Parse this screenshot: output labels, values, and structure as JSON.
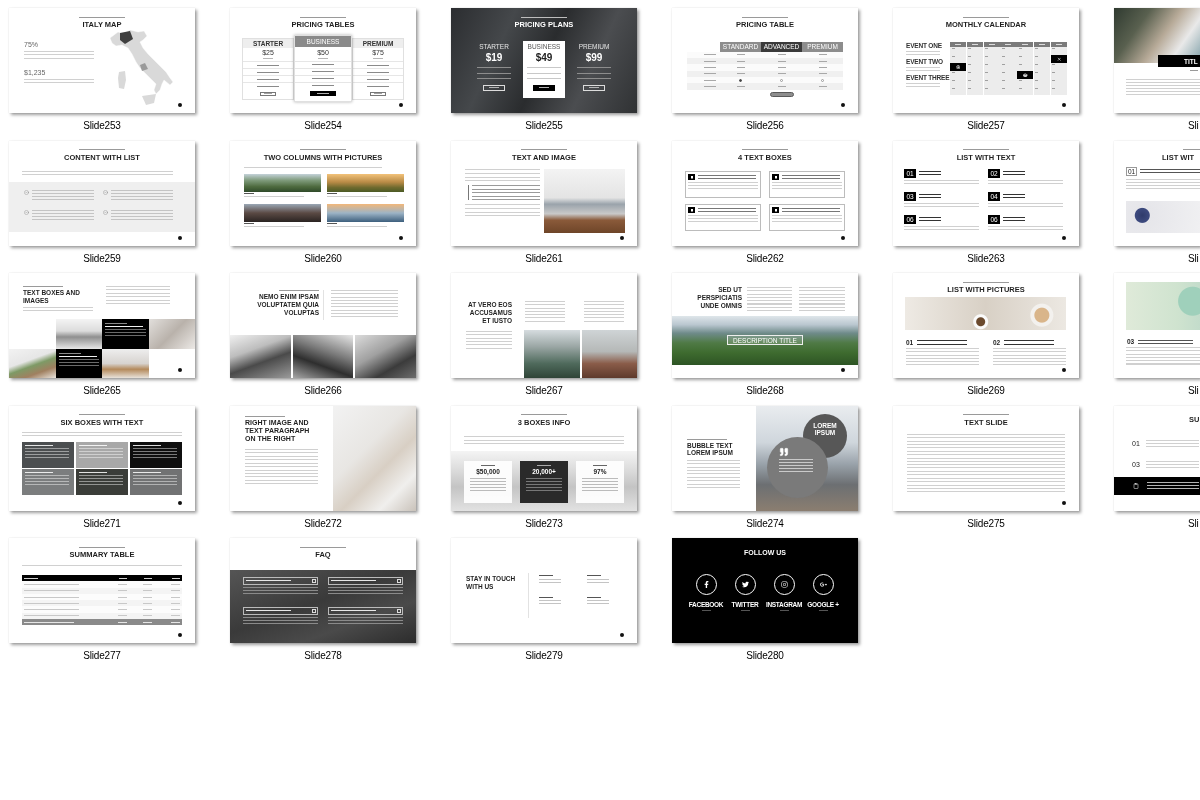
{
  "slides": [
    {
      "label": "Slide253",
      "kind": "map",
      "title": "ITALY MAP",
      "stats": [
        "75%",
        "$1,235"
      ]
    },
    {
      "label": "Slide254",
      "kind": "pricing_tables",
      "title": "PRICING TABLES",
      "plans": [
        {
          "name": "STARTER",
          "price": "$25",
          "highlighted": false
        },
        {
          "name": "BUSINESS",
          "price": "$50",
          "highlighted": true
        },
        {
          "name": "PREMIUM",
          "price": "$75",
          "highlighted": false
        }
      ]
    },
    {
      "label": "Slide255",
      "kind": "pricing_plans",
      "title": "PRICING PLANS",
      "plans": [
        {
          "name": "STARTER",
          "price": "$19",
          "highlighted": false
        },
        {
          "name": "BUSINESS",
          "price": "$49",
          "highlighted": true
        },
        {
          "name": "PREMIUM",
          "price": "$99",
          "highlighted": false
        }
      ]
    },
    {
      "label": "Slide256",
      "kind": "pricing_table",
      "title": "PRICING TABLE",
      "columns": [
        {
          "name": "STANDARD",
          "highlighted": false
        },
        {
          "name": "ADVANCED",
          "highlighted": true
        },
        {
          "name": "PREMIUM",
          "highlighted": false
        }
      ]
    },
    {
      "label": "Slide257",
      "kind": "calendar",
      "title": "MONTHLY CALENDAR",
      "events": [
        "EVENT ONE",
        "EVENT TWO",
        "EVENT THREE"
      ],
      "weeks": [
        [
          {
            "marked": false
          },
          {
            "marked": false
          },
          {
            "marked": false
          },
          {
            "marked": false
          },
          {
            "marked": false
          },
          {
            "marked": false
          },
          {
            "marked": false
          }
        ],
        [
          {
            "marked": false
          },
          {
            "marked": false
          },
          {
            "marked": false
          },
          {
            "marked": false
          },
          {
            "marked": false
          },
          {
            "marked": false
          },
          {
            "marked": true
          }
        ],
        [
          {
            "marked": true
          },
          {
            "marked": false
          },
          {
            "marked": false
          },
          {
            "marked": false
          },
          {
            "marked": false
          },
          {
            "marked": false
          },
          {
            "marked": false
          }
        ],
        [
          {
            "marked": false
          },
          {
            "marked": false
          },
          {
            "marked": false
          },
          {
            "marked": false
          },
          {
            "marked": true
          },
          {
            "marked": false
          },
          {
            "marked": false
          }
        ],
        [
          {
            "marked": false
          },
          {
            "marked": false
          },
          {
            "marked": false
          },
          {
            "marked": false
          },
          {
            "marked": false
          },
          {
            "marked": false
          },
          {
            "marked": false
          }
        ],
        [
          {
            "marked": false
          },
          {
            "marked": false
          },
          {
            "marked": false
          },
          {
            "marked": false
          },
          {
            "marked": false
          },
          {
            "marked": false
          },
          {
            "marked": false
          }
        ]
      ]
    },
    {
      "label": "Sli",
      "kind": "cut_photo_title",
      "title": "TITL"
    },
    {
      "label": "Slide259",
      "kind": "content_list",
      "title": "CONTENT WITH LIST"
    },
    {
      "label": "Slide260",
      "kind": "two_columns_pictures",
      "title": "TWO COLUMNS WITH PICTURES"
    },
    {
      "label": "Slide261",
      "kind": "text_image",
      "title": "TEXT AND IMAGE"
    },
    {
      "label": "Slide262",
      "kind": "text_boxes",
      "title": "4 TEXT BOXES"
    },
    {
      "label": "Slide263",
      "kind": "list_text",
      "title": "LIST WITH TEXT",
      "items": [
        {
          "number": "01"
        },
        {
          "number": "02"
        },
        {
          "number": "03"
        },
        {
          "number": "04"
        },
        {
          "number": "06"
        },
        {
          "number": "06"
        }
      ]
    },
    {
      "label": "Sli",
      "kind": "cut_list_picture",
      "title": "LIST WIT",
      "number": "01"
    },
    {
      "label": "Slide265",
      "kind": "text_boxes_images",
      "title": "TEXT BOXES AND IMAGES"
    },
    {
      "label": "Slide266",
      "kind": "heading_three_photos",
      "title": "NEMO ENIM IPSAM VOLUPTATEM QUIA VOLUPTAS"
    },
    {
      "label": "Slide267",
      "kind": "heading_two_photos",
      "title": "AT VERO EOS ACCUSAMUS ET IUSTO"
    },
    {
      "label": "Slide268",
      "kind": "heading_landscape",
      "title": "SED UT PERSPICIATIS UNDE OMNIS",
      "caption": "DESCRIPTION TITLE"
    },
    {
      "label": "Slide269",
      "kind": "list_pictures",
      "title": "LIST WITH PICTURES",
      "items": [
        {
          "number": "01"
        },
        {
          "number": "02"
        }
      ]
    },
    {
      "label": "Sli",
      "kind": "cut_picture_number",
      "number": "03"
    },
    {
      "label": "Slide271",
      "kind": "six_boxes",
      "title": "SIX BOXES WITH TEXT",
      "boxes": [
        {
          "color": "#4b4e50"
        },
        {
          "color": "#a8a8a8"
        },
        {
          "color": "#0f0f0f"
        },
        {
          "color": "#7b7d7e"
        },
        {
          "color": "#3b3d39"
        },
        {
          "color": "#717273"
        }
      ]
    },
    {
      "label": "Slide272",
      "kind": "right_image",
      "title": "RIGHT IMAGE AND TEXT PARAGRAPH ON THE RIGHT"
    },
    {
      "label": "Slide273",
      "kind": "three_boxes",
      "title": "3 BOXES INFO",
      "boxes": [
        {
          "value": "$50,000",
          "highlighted": false
        },
        {
          "value": "20,000+",
          "highlighted": true
        },
        {
          "value": "97%",
          "highlighted": false
        }
      ]
    },
    {
      "label": "Slide274",
      "kind": "bubble",
      "title": "BUBBLE TEXT LOREM IPSUM",
      "bubble": "LOREM IPSUM"
    },
    {
      "label": "Slide275",
      "kind": "text_slide",
      "title": "TEXT SLIDE"
    },
    {
      "label": "Sli",
      "kind": "cut_summary",
      "title": "SU",
      "numbers": [
        "01",
        "03"
      ]
    },
    {
      "label": "Slide277",
      "kind": "summary_table",
      "title": "SUMMARY TABLE"
    },
    {
      "label": "Slide278",
      "kind": "faq",
      "title": "FAQ"
    },
    {
      "label": "Slide279",
      "kind": "contact",
      "title": "STAY IN TOUCH WITH US"
    },
    {
      "label": "Slide280",
      "kind": "follow",
      "title": "FOLLOW US",
      "networks": [
        "FACEBOOK",
        "TWITTER",
        "INSTAGRAM",
        "GOOGLE +"
      ]
    }
  ]
}
